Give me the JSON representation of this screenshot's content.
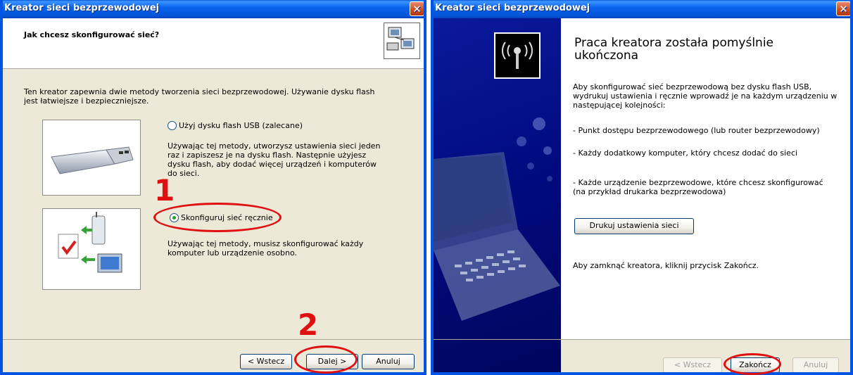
{
  "left_dialog": {
    "title": "Kreator sieci bezprzewodowej",
    "header_question": "Jak chcesz skonfigurować sieć?",
    "intro_line1": "Ten kreator zapewnia dwie metody tworzenia sieci bezprzewodowej. Używanie dysku flash",
    "intro_line2": "jest łatwiejsze i bezpieczniejsze.",
    "option_usb_label": "Użyj dysku flash USB (zalecane)",
    "option_usb_desc": [
      "Używając tej metody, utworzysz ustawienia sieci jeden",
      "raz i zapiszesz je na dysku flash. Następnie użyjesz",
      "dysku flash, aby dodać więcej urządzeń i komputerów",
      "do sieci."
    ],
    "option_manual_label": "Skonfiguruj sieć ręcznie",
    "option_manual_desc": [
      "Używając tej metody, musisz skonfigurować każdy",
      "komputer lub urządzenie osobno."
    ],
    "selected_option": "manual",
    "buttons": {
      "back": "< Wstecz",
      "next": "Dalej >",
      "cancel": "Anuluj"
    }
  },
  "annotations": {
    "step1": "1",
    "step2": "2",
    "color": "#e01010"
  },
  "right_dialog": {
    "title": "Kreator sieci bezprzewodowej",
    "heading_line1": "Praca kreatora została pomyślnie",
    "heading_line2": "ukończona",
    "para1": [
      "Aby skonfigurować sieć bezprzewodową bez dysku flash USB,",
      "wydrukuj ustawienia i ręcznie wprowadź je na każdym urządzeniu w",
      "następującej kolejności:"
    ],
    "item1": "- Punkt dostępu bezprzewodowego (lub router bezprzewodowy)",
    "item2": "- Każdy dodatkowy komputer, który chcesz dodać do sieci",
    "item3": [
      "- Każde urządzenie bezprzewodowe, które chcesz skonfigurować",
      "(na przykład drukarka bezprzewodowa)"
    ],
    "print_button": "Drukuj ustawienia sieci",
    "closing_text": "Aby zamknąć kreatora, kliknij przycisk Zakończ.",
    "buttons": {
      "back": "< Wstecz",
      "finish": "Zakończ",
      "cancel": "Anuluj"
    }
  },
  "colors": {
    "titlebar": "#0a64ec",
    "sidebar": "#00087a",
    "dialog_bg": "#ece9d8"
  }
}
